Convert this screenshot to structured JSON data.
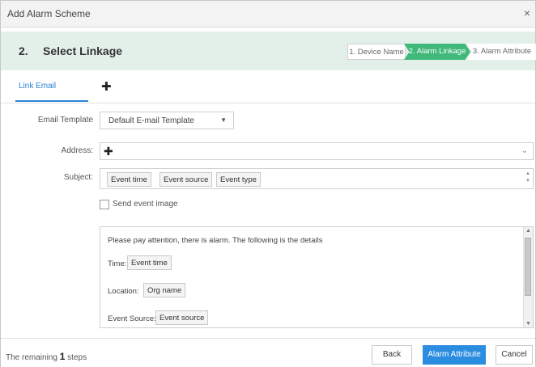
{
  "window": {
    "title": "Add Alarm Scheme",
    "close_glyph": "×"
  },
  "step": {
    "number": "2.",
    "title": "Select Linkage",
    "breadcrumb": [
      "1. Device Name",
      "2. Alarm Linkage",
      "3. Alarm Attribute"
    ]
  },
  "tabs": {
    "active": "Link Email",
    "add_glyph": "✚"
  },
  "form": {
    "email_template": {
      "label": "Email Template",
      "value": "Default E-mail Template",
      "caret": "▼"
    },
    "address": {
      "label": "Address:",
      "add_glyph": "✚",
      "chevron": "⌄"
    },
    "subject": {
      "label": "Subject:",
      "tags": [
        "Event time",
        "Event source",
        "Event type"
      ]
    },
    "send_image": {
      "label": "Send event image",
      "checked": false
    }
  },
  "editor": {
    "intro": "Please pay attention, there is alarm. The following is the details",
    "rows": [
      {
        "label": "Time:",
        "tag": "Event time"
      },
      {
        "label": "Location:",
        "tag": "Org name"
      },
      {
        "label": "Event Source:",
        "tag": "Event source"
      }
    ]
  },
  "footer": {
    "remaining_prefix": "The remaining",
    "remaining_count": "1",
    "remaining_suffix": "steps",
    "back": "Back",
    "next": "Alarm Attribute",
    "cancel": "Cancel"
  },
  "colors": {
    "accent": "#2b8de0",
    "step_active": "#3fb87a",
    "step_bar": "#e3f0ea"
  },
  "icons": {
    "close": "close-icon",
    "add": "plus-icon",
    "dropdown": "chevron-down-icon"
  }
}
